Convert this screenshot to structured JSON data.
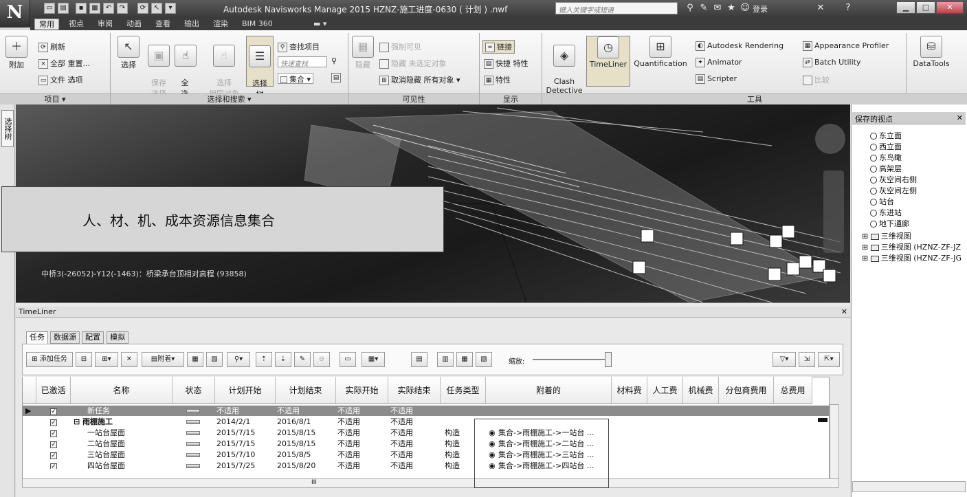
{
  "titlebar": {
    "app_logo": "N",
    "title": "Autodesk Navisworks Manage 2015    HZNZ-施工进度-0630 ( 计划 ) .nwf",
    "search_placeholder": "键入关键字或短语",
    "login": "登录"
  },
  "tabs": [
    "常用",
    "视点",
    "审阅",
    "动画",
    "查看",
    "输出",
    "渲染",
    "BIM 360"
  ],
  "ribbon": {
    "project": {
      "append": "附加",
      "refresh": "刷新",
      "reset_all": "全部 重置...",
      "file_options": "文件 选项",
      "footer": "项目 ▾"
    },
    "select_search": {
      "select": "选择",
      "save_selection": "保存\n选择",
      "select_all": "全\n选",
      "select_same": "选择\n相同对象",
      "selection_tree": "选择\n树",
      "find_items": "查找项目",
      "quick_find_placeholder": "快速查找",
      "sets": "集合",
      "footer": "选择和搜索 ▾"
    },
    "visibility": {
      "hide": "隐藏",
      "require": "强制可见",
      "hide_unselected": "隐藏 未选定对象",
      "unhide_all": "取消隐藏 所有对象",
      "footer": "可见性"
    },
    "display": {
      "links": "链接",
      "quick_props": "快捷 特性",
      "props": "特性",
      "footer": "显示"
    },
    "tools": {
      "clash": "Clash\nDetective",
      "timeliner": "TimeLiner",
      "quantification": "Quantification",
      "rendering": "Autodesk Rendering",
      "animator": "Animator",
      "scripter": "Scripter",
      "appearance": "Appearance Profiler",
      "batch": "Batch Utility",
      "compare": "比较",
      "datatools": "DataTools",
      "footer": "工具"
    }
  },
  "left_tab": "选择树",
  "viewport": {
    "annotation": "人、材、机、成本资源信息集合",
    "status": "中桥3(-26052)-Y12(-1463)：桥梁承台顶相对高程 (93858)"
  },
  "saved_viewpoints": {
    "title": "保存的视点",
    "items": [
      "东立面",
      "西立面",
      "东鸟瞰",
      "高架层",
      "灰空间右侧",
      "灰空间左侧",
      "站台",
      "东进站",
      "地下通廊"
    ],
    "folders": [
      "三维视图",
      "三维视图 (HZNZ-ZF-JZ",
      "三维视图 (HZNZ-ZF-JG"
    ]
  },
  "timeliner": {
    "title": "TimeLiner",
    "tabs": [
      "任务",
      "数据源",
      "配置",
      "模拟"
    ],
    "toolbar": {
      "add_task": "添加任务",
      "attach": "附着",
      "zoom": "缩放:"
    },
    "columns": [
      "已激活",
      "名称",
      "状态",
      "计划开始",
      "计划结束",
      "实际开始",
      "实际结束",
      "任务类型",
      "附着的",
      "材料费",
      "人工费",
      "机械费",
      "分包商费用",
      "总费用"
    ],
    "rows": [
      {
        "name": "新任务",
        "plan_start": "不适用",
        "plan_end": "不适用",
        "act_start": "不适用",
        "act_end": "不适用",
        "type": "",
        "attached": ""
      },
      {
        "name": "⊟ 雨棚施工",
        "plan_start": "2014/2/1",
        "plan_end": "2016/8/1",
        "act_start": "不适用",
        "act_end": "不适用",
        "type": "",
        "attached": ""
      },
      {
        "name": "一站台屋面",
        "plan_start": "2015/7/15",
        "plan_end": "2015/8/15",
        "act_start": "不适用",
        "act_end": "不适用",
        "type": "构造",
        "attached": "集合->雨棚施工->一站台 ..."
      },
      {
        "name": "二站台屋面",
        "plan_start": "2015/7/15",
        "plan_end": "2015/8/15",
        "act_start": "不适用",
        "act_end": "不适用",
        "type": "构造",
        "attached": "集合->雨棚施工->二站台 ..."
      },
      {
        "name": "三站台屋面",
        "plan_start": "2015/7/10",
        "plan_end": "2015/8/5",
        "act_start": "不适用",
        "act_end": "不适用",
        "type": "构造",
        "attached": "集合->雨棚施工->三站台 ..."
      },
      {
        "name": "四站台屋面",
        "plan_start": "2015/7/25",
        "plan_end": "2015/8/20",
        "act_start": "不适用",
        "act_end": "不适用",
        "type": "构造",
        "attached": "集合->雨棚施工->四站台 ..."
      }
    ],
    "hscroll_label": "III"
  }
}
